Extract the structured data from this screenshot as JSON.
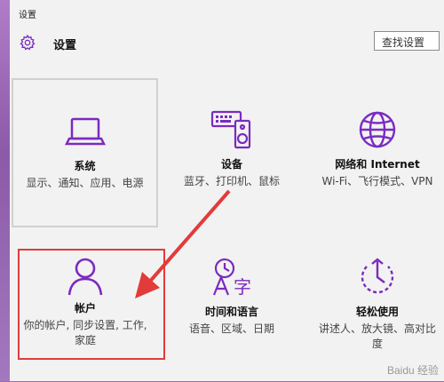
{
  "window": {
    "title": "设置"
  },
  "header": {
    "app_name": "设置",
    "search_placeholder": "查找设置"
  },
  "tiles": [
    {
      "title": "系统",
      "desc": "显示、通知、应用、电源"
    },
    {
      "title": "设备",
      "desc": "蓝牙、打印机、鼠标"
    },
    {
      "title": "网络和 Internet",
      "desc": "Wi-Fi、飞行模式、VPN"
    },
    {
      "title": "帐户",
      "desc": "你的帐户, 同步设置, 工作, 家庭"
    },
    {
      "title": "时间和语言",
      "desc": "语音、区域、日期"
    },
    {
      "title": "轻松使用",
      "desc": "讲述人、放大镜、高对比度"
    }
  ],
  "watermark": "Baidu 经验",
  "colors": {
    "accent": "#7b2bbf",
    "annotation": "#e23b3b"
  }
}
